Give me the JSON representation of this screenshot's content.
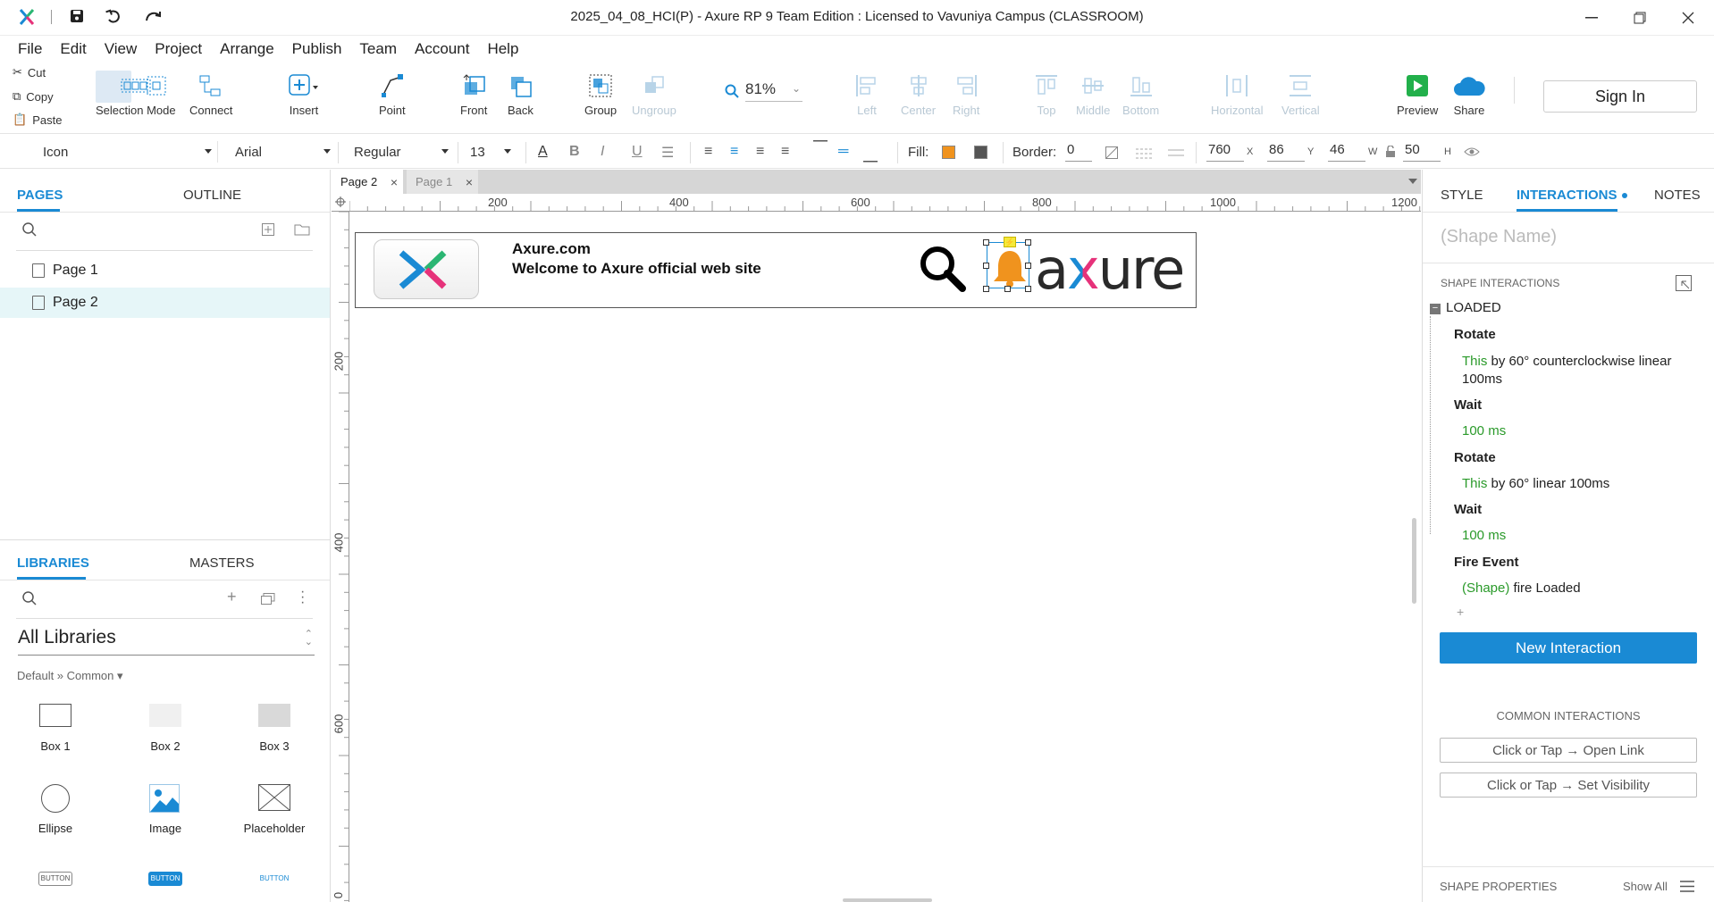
{
  "window": {
    "title": "2025_04_08_HCI(P) - Axure RP 9 Team Edition : Licensed to Vavuniya Campus (CLASSROOM)"
  },
  "menu": [
    "File",
    "Edit",
    "View",
    "Project",
    "Arrange",
    "Publish",
    "Team",
    "Account",
    "Help"
  ],
  "clipboard": {
    "cut": "Cut",
    "copy": "Copy",
    "paste": "Paste"
  },
  "toolbar": {
    "selection_mode": "Selection Mode",
    "connect": "Connect",
    "insert": "Insert",
    "point": "Point",
    "front": "Front",
    "back": "Back",
    "group": "Group",
    "ungroup": "Ungroup",
    "zoom": "81%",
    "left": "Left",
    "center": "Center",
    "right": "Right",
    "top": "Top",
    "middle": "Middle",
    "bottom": "Bottom",
    "horizontal": "Horizontal",
    "vertical": "Vertical",
    "preview": "Preview",
    "share": "Share",
    "sign_in": "Sign In"
  },
  "format": {
    "style": "Icon",
    "font": "Arial",
    "weight": "Regular",
    "size": "13",
    "fill_label": "Fill:",
    "fill_color": "#f0931e",
    "border_label": "Border:",
    "border_value": "0",
    "x": "760",
    "x_unit": "X",
    "y": "86",
    "y_unit": "Y",
    "w": "46",
    "w_unit": "W",
    "h": "50",
    "h_unit": "H"
  },
  "left": {
    "pages_tab": "PAGES",
    "outline_tab": "OUTLINE",
    "pages": [
      {
        "label": "Page 1"
      },
      {
        "label": "Page 2"
      }
    ],
    "libraries_tab": "LIBRARIES",
    "masters_tab": "MASTERS",
    "library_select": "All Libraries",
    "breadcrumb": "Default » Common ▾",
    "widgets": [
      "Box 1",
      "Box 2",
      "Box 3",
      "Ellipse",
      "Image",
      "Placeholder"
    ],
    "button_labels": [
      "BUTTON",
      "BUTTON",
      "BUTTON"
    ]
  },
  "doc_tabs": [
    {
      "label": "Page 2"
    },
    {
      "label": "Page 1"
    }
  ],
  "ruler": {
    "h": [
      "200",
      "400",
      "600",
      "800",
      "1000",
      "1200"
    ],
    "v": [
      "200",
      "400",
      "600",
      "0"
    ]
  },
  "canvas": {
    "header_line1": "Axure.com",
    "header_line2": "Welcome to Axure official web site",
    "logo_text": "axure"
  },
  "right": {
    "style_tab": "STYLE",
    "interactions_tab": "INTERACTIONS",
    "notes_tab": "NOTES",
    "shape_name_placeholder": "(Shape Name)",
    "shape_interactions": "SHAPE INTERACTIONS",
    "event": "LOADED",
    "actions": [
      {
        "name": "Rotate",
        "target": "This",
        "detail": " by 60° counterclockwise linear",
        "detail2": "100ms"
      },
      {
        "name": "Wait",
        "value": "100 ms"
      },
      {
        "name": "Rotate",
        "target": "This",
        "detail": " by 60° linear 100ms"
      },
      {
        "name": "Wait",
        "value": "100 ms"
      },
      {
        "name": "Fire Event",
        "target": "(Shape)",
        "detail": " fire Loaded"
      }
    ],
    "add_symbol": "+",
    "new_interaction": "New Interaction",
    "common_interactions": "COMMON INTERACTIONS",
    "common": [
      "Click or Tap → Open Link",
      "Click or Tap → Set Visibility"
    ],
    "shape_properties": "SHAPE PROPERTIES",
    "show_all": "Show All"
  },
  "colors": {
    "accent": "#1a8ad4",
    "green": "#2a9a2a",
    "bell": "#f0931e"
  }
}
